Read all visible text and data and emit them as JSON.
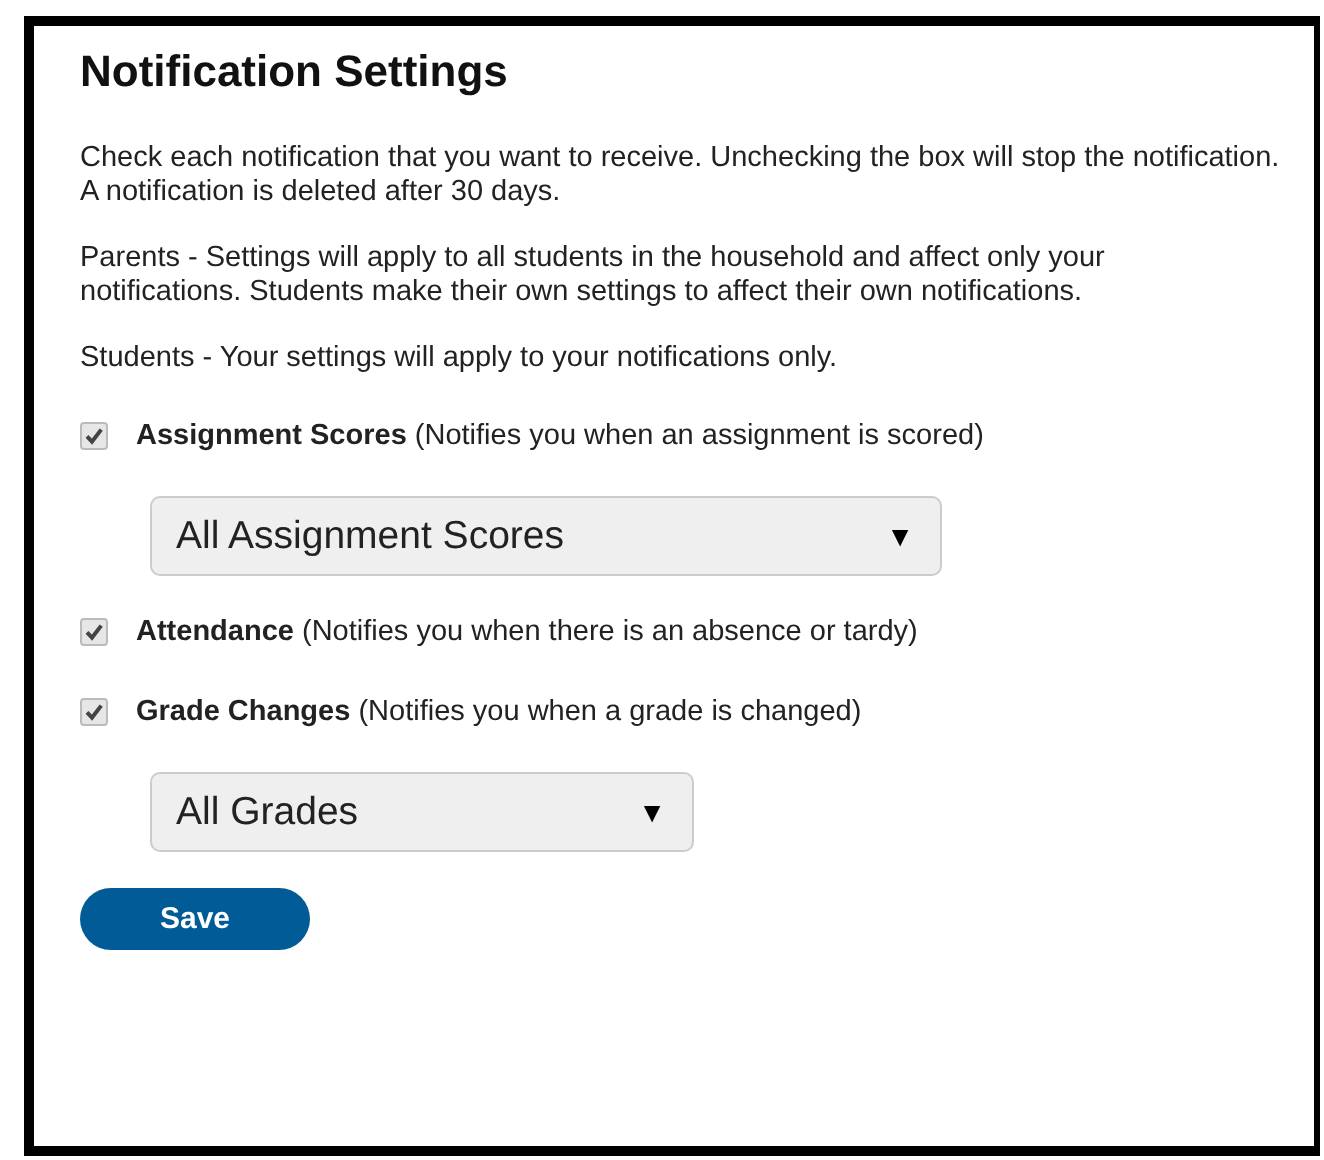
{
  "dialog": {
    "title": "Notification Settings",
    "paragraphs": [
      "Check each notification that you want to receive. Unchecking the box will stop the notification. A notification is deleted after 30 days.",
      "Parents - Settings will apply to all students in the household and affect only your notifications. Students make their own settings to affect their own notifications.",
      "Students - Your settings will apply to your notifications only."
    ],
    "notifications": [
      {
        "label": "Assignment Scores",
        "description": "(Notifies you when an assignment is scored)",
        "checked": true,
        "select": {
          "value": "All Assignment Scores",
          "arrow": "▼"
        }
      },
      {
        "label": "Attendance",
        "description": "(Notifies you when there is an absence or tardy)",
        "checked": true
      },
      {
        "label": "Grade Changes",
        "description": "(Notifies you when a grade is changed)",
        "checked": true,
        "select": {
          "value": "All Grades",
          "arrow": "▼"
        }
      }
    ],
    "save_button": "Save"
  }
}
